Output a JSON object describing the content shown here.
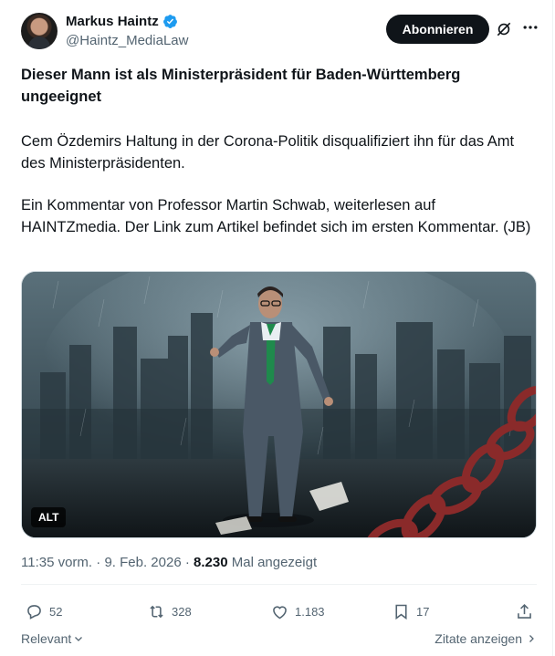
{
  "author": {
    "display_name": "Markus Haintz",
    "handle": "@Haintz_MediaLaw",
    "verified": true
  },
  "follow_button": "Abonnieren",
  "post": {
    "title": "Dieser Mann ist als Ministerpräsident für Baden-Württemberg ungeeignet",
    "paragraph1": "Cem Özdemirs Haltung in der Corona-Politik disqualifiziert ihn für das Amt des Ministerpräsidenten.",
    "paragraph2": "Ein Kommentar von Professor Martin Schwab, weiterlesen auf HAINTZmedia.  Der Link zum Artikel befindet sich im ersten Kommentar. (JB)"
  },
  "media": {
    "alt_badge": "ALT"
  },
  "meta": {
    "time": "11:35 vorm.",
    "separator1": " · ",
    "date": "9. Feb. 2026",
    "separator2": " · ",
    "views_count": "8.230",
    "views_label": " Mal angezeigt"
  },
  "actions": {
    "replies": "52",
    "reposts": "328",
    "likes": "1.183",
    "bookmarks": "17"
  },
  "footer": {
    "sort_label": "Relevant",
    "quotes_label": "Zitate anzeigen"
  },
  "colors": {
    "verified": "#1d9bf0",
    "text_primary": "#0f1419",
    "text_secondary": "#536471",
    "button_dark": "#0f1419"
  },
  "icons": [
    "verified-badge-icon",
    "grok-icon",
    "more-icon",
    "reply-icon",
    "repost-icon",
    "like-icon",
    "bookmark-icon",
    "share-icon",
    "chevron-down-icon",
    "chevron-right-icon"
  ]
}
